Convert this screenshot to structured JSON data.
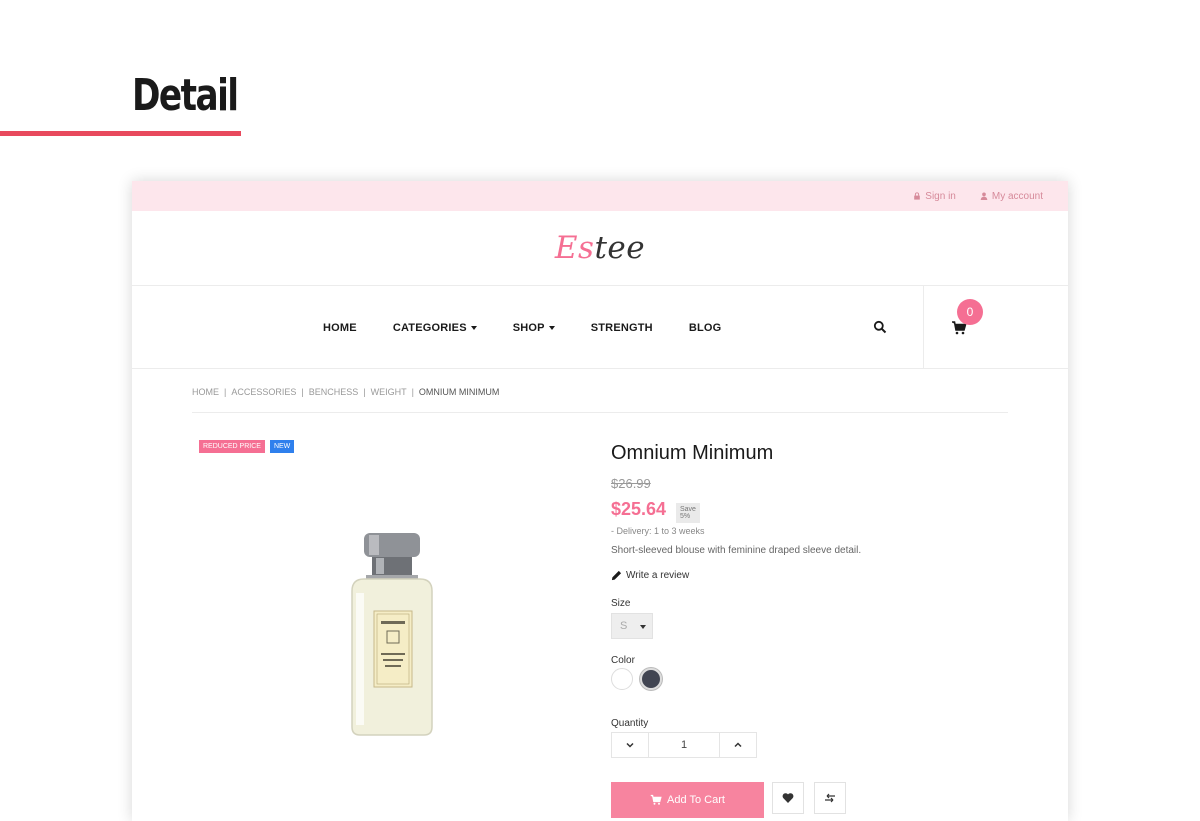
{
  "page": {
    "heading": "Detail"
  },
  "topbar": {
    "sign_in": "Sign in",
    "my_account": "My account"
  },
  "brand": {
    "logo_accent": "Es",
    "logo_rest": "tee"
  },
  "nav": {
    "items": [
      {
        "label": "HOME",
        "dropdown": false
      },
      {
        "label": "CATEGORIES",
        "dropdown": true
      },
      {
        "label": "SHOP",
        "dropdown": true
      },
      {
        "label": "STRENGTH",
        "dropdown": false
      },
      {
        "label": "BLOG",
        "dropdown": false
      }
    ],
    "cart_count": "0"
  },
  "breadcrumb": [
    "HOME",
    "ACCESSORIES",
    "BENCHESS",
    "WEIGHT",
    "OMNIUM MINIMUM"
  ],
  "product": {
    "badge_reduced": "REDUCED PRICE",
    "badge_new": "NEW",
    "title": "Omnium Minimum",
    "old_price": "$26.99",
    "price": "$25.64",
    "save": "Save 5%",
    "delivery": "- Delivery: 1 to 3 weeks",
    "description": "Short-sleeved blouse with feminine draped sleeve detail.",
    "review_link": "Write a review",
    "size_label": "Size",
    "size_value": "S",
    "color_label": "Color",
    "colors": [
      "#ffffff",
      "#414552"
    ],
    "quantity_label": "Quantity",
    "quantity": "1",
    "add_to_cart": "Add To Cart"
  },
  "colors": {
    "accent": "#f56f93",
    "topbar_bg": "#fde6ec",
    "badge_new": "#2f80ed",
    "underline": "#e8495d"
  }
}
